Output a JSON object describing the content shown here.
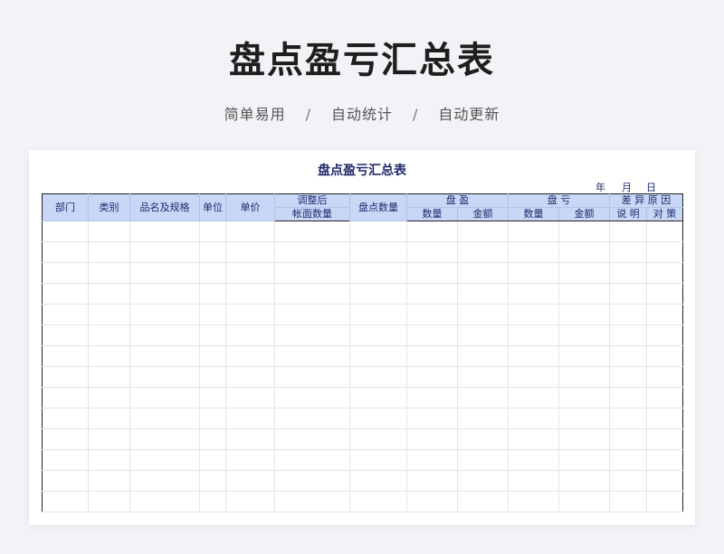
{
  "hero": {
    "title": "盘点盈亏汇总表",
    "features": [
      "简单易用",
      "自动统计",
      "自动更新"
    ],
    "separator": "/"
  },
  "sheet": {
    "title": "盘点盈亏汇总表",
    "date": {
      "year": "年",
      "month": "月",
      "day": "日"
    },
    "header_top": {
      "dept": "部门",
      "category": "类别",
      "name_spec": "品名及规格",
      "unit": "单位",
      "price": "单价",
      "adjusted_line1": "调整后",
      "adjusted_line2": "帐面数量",
      "count_qty": "盘点数量",
      "surplus": "盘 盈",
      "loss": "盘 亏",
      "diff_reason": "差 异 原 因"
    },
    "header_sub": {
      "surplus_qty": "数量",
      "surplus_amount": "金额",
      "loss_qty": "数量",
      "loss_amount": "金额",
      "explain": "说  明",
      "measure": "对  策"
    },
    "empty_rows": 14
  },
  "colors": {
    "header_bg": "#c9d7f7",
    "header_text": "#1f2a6b",
    "page_bg": "#f1f3f6"
  }
}
